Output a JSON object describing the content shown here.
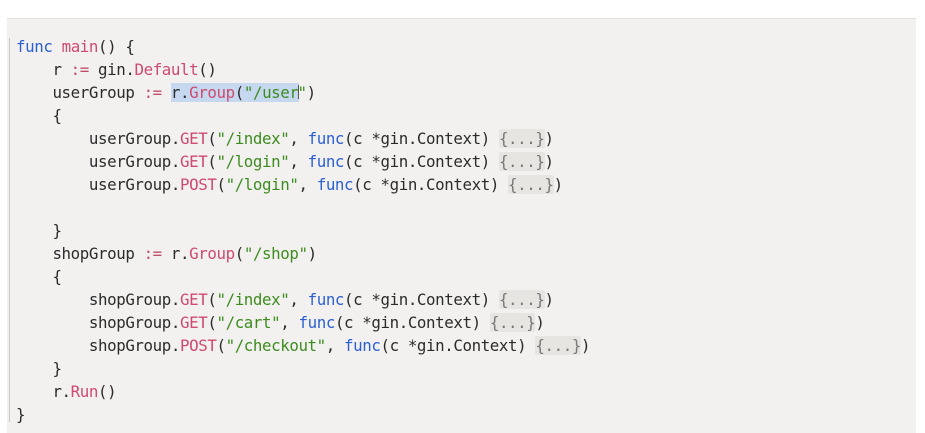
{
  "editor": {
    "code_lines": [
      "func main() {",
      "    r := gin.Default()",
      "    userGroup := r.Group(\"/user\")",
      "    {",
      "        userGroup.GET(\"/index\", func(c *gin.Context) {...})",
      "        userGroup.GET(\"/login\", func(c *gin.Context) {...})",
      "        userGroup.POST(\"/login\", func(c *gin.Context) {...})",
      "",
      "    }",
      "    shopGroup := r.Group(\"/shop\")",
      "    {",
      "        shopGroup.GET(\"/index\", func(c *gin.Context) {...})",
      "        shopGroup.GET(\"/cart\", func(c *gin.Context) {...})",
      "        shopGroup.POST(\"/checkout\", func(c *gin.Context) {...})",
      "    }",
      "    r.Run()",
      "}"
    ],
    "selected_text": "r.Group(\"/user",
    "colors": {
      "background": "#f2f1ef",
      "keyword": "#2c5fd1",
      "function": "#ce4a6f",
      "string": "#3d8c20",
      "selection": "#c6d8ef"
    }
  }
}
